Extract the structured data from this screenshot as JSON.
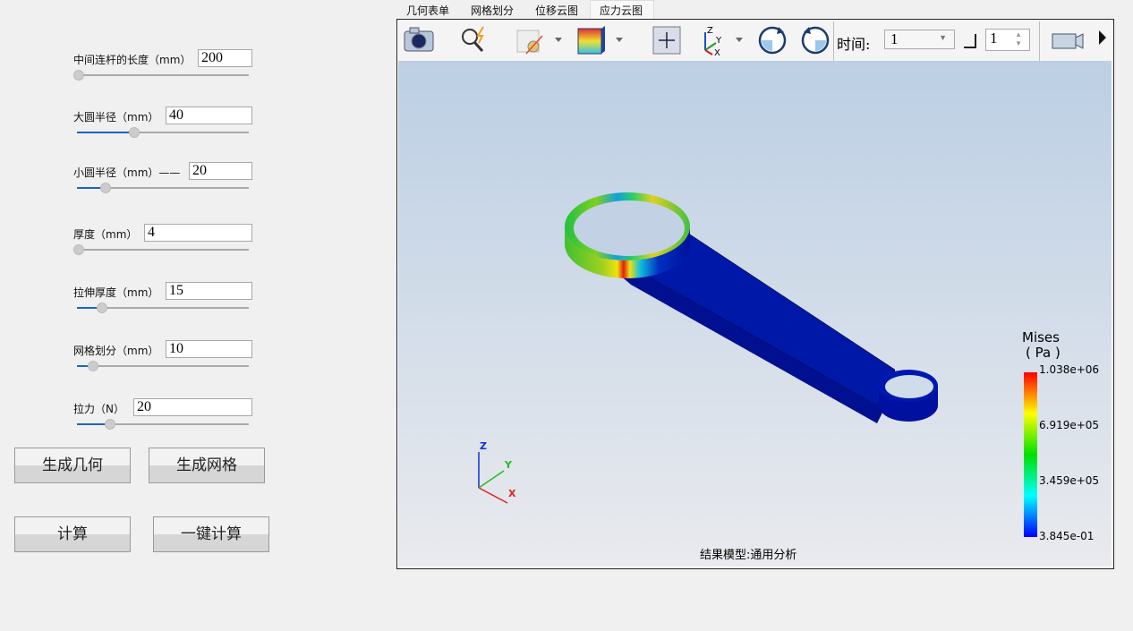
{
  "params": [
    {
      "label": "中间连杆的长度（mm）",
      "value": "200",
      "slider": 0.0
    },
    {
      "label": "大圆半径（mm）",
      "value": "40",
      "slider": 0.33
    },
    {
      "label": "小圆半径（mm）——",
      "value": "20",
      "slider": 0.16
    },
    {
      "label": "厚度（mm）",
      "value": "4",
      "slider": 0.0
    },
    {
      "label": "拉伸厚度（mm）",
      "value": "15",
      "slider": 0.14
    },
    {
      "label": "网格划分（mm）",
      "value": "10",
      "slider": 0.09
    },
    {
      "label": "拉力（N）",
      "value": "20",
      "slider": 0.19
    }
  ],
  "buttons": {
    "gen_geometry": "生成几何",
    "gen_mesh": "生成网格",
    "compute": "计算",
    "one_click": "一键计算"
  },
  "tabs": [
    "几何表单",
    "网格划分",
    "位移云图",
    "应力云图"
  ],
  "active_tab": 3,
  "toolbar": {
    "time_label": "时间:",
    "time_value": "1",
    "step_value": "1"
  },
  "legend": {
    "title": "Mises",
    "unit": "( Pa )",
    "ticks": [
      "1.038e+06",
      "6.919e+05",
      "3.459e+05",
      "3.845e-01"
    ]
  },
  "axes": {
    "z": "Z",
    "y": "Y",
    "x": "X"
  },
  "status": "结果模型:通用分析"
}
